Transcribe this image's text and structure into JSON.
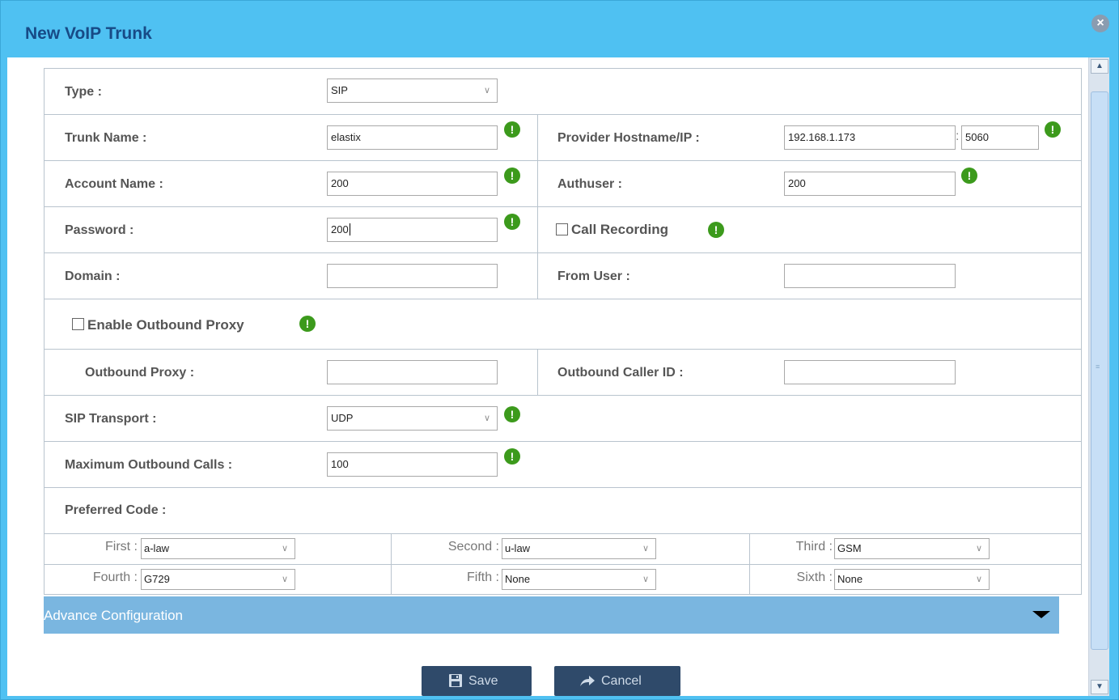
{
  "dialog": {
    "title": "New VoIP Trunk",
    "close_icon": "close-circle-icon"
  },
  "form": {
    "type_label": "Type :",
    "type_value": "SIP",
    "trunk_name_label": "Trunk Name :",
    "trunk_name_value": "elastix",
    "provider_label": "Provider Hostname/IP :",
    "provider_value": "192.168.1.173",
    "port_separator": ":",
    "port_value": "5060",
    "account_name_label": "Account Name :",
    "account_name_value": "200",
    "authuser_label": "Authuser :",
    "authuser_value": "200",
    "password_label": "Password :",
    "password_value": "200",
    "call_recording_label": "Call Recording",
    "domain_label": "Domain :",
    "domain_value": "",
    "from_user_label": "From User :",
    "from_user_value": "",
    "enable_proxy_label": "Enable Outbound Proxy",
    "outbound_proxy_label": "Outbound Proxy :",
    "outbound_proxy_value": "",
    "outbound_caller_id_label": "Outbound Caller ID :",
    "outbound_caller_id_value": "",
    "sip_transport_label": "SIP Transport :",
    "sip_transport_value": "UDP",
    "max_calls_label": "Maximum Outbound Calls :",
    "max_calls_value": "100",
    "preferred_code_label": "Preferred Code :",
    "info_glyph": "!",
    "chevron_glyph": "∨"
  },
  "codecs": [
    {
      "label": "First :",
      "value": "a-law"
    },
    {
      "label": "Second :",
      "value": "u-law"
    },
    {
      "label": "Third :",
      "value": "GSM"
    },
    {
      "label": "Fourth :",
      "value": "G729"
    },
    {
      "label": "Fifth :",
      "value": "None"
    },
    {
      "label": "Sixth :",
      "value": "None"
    }
  ],
  "advance": {
    "label": "Advance Configuration"
  },
  "buttons": {
    "save": "Save",
    "cancel": "Cancel"
  },
  "colors": {
    "title_bar": "#4fc1f2",
    "title_text": "#174a86",
    "info_icon": "#3c9a1c",
    "advance_bar": "#7ab6e0",
    "button": "#2f4a6a"
  }
}
